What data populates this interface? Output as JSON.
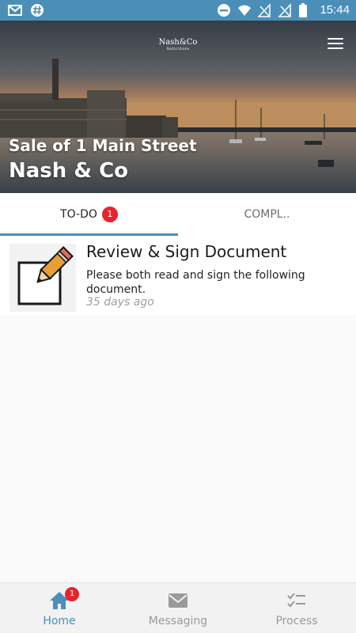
{
  "status_bar": {
    "time": "15:44",
    "left_icons": [
      "gmail-icon",
      "slack-icon"
    ],
    "right_icons": [
      "do-not-disturb-icon",
      "wifi-icon",
      "no-sim-icon",
      "no-sim-icon",
      "battery-icon"
    ]
  },
  "header": {
    "logo_main": "Nash&Co",
    "logo_sub": "Solicitors",
    "subtitle": "Sale of 1 Main Street",
    "title": "Nash & Co"
  },
  "tabs": [
    {
      "label": "TO-DO",
      "badge": "1",
      "active": true
    },
    {
      "label": "COMPL..",
      "active": false
    }
  ],
  "tasks": [
    {
      "title": "Review & Sign Document",
      "description": "Please both read and sign the following document.",
      "time": "35 days ago",
      "icon": "pencil-edit-icon"
    }
  ],
  "bottom_nav": [
    {
      "label": "Home",
      "icon": "home-icon",
      "badge": "1",
      "active": true
    },
    {
      "label": "Messaging",
      "icon": "mail-icon",
      "active": false
    },
    {
      "label": "Process",
      "icon": "checklist-icon",
      "active": false
    }
  ],
  "colors": {
    "accent": "#4b8fb8",
    "badge": "#e8232f",
    "status_bar": "#4b8fb8"
  }
}
